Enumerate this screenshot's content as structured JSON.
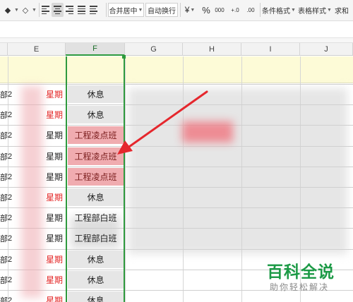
{
  "ribbon": {
    "merge_center_label": "合并居中",
    "wrap_text_label": "自动换行",
    "percent_symbol": "%",
    "thousands_symbol": "000",
    "inc_decimal_label": "+.0",
    "dec_decimal_label": ".00",
    "conditional_format_label": "条件格式",
    "table_style_label": "表格样式",
    "sum_label": "求和"
  },
  "columns": [
    "E",
    "F",
    "G",
    "H",
    "I",
    "J"
  ],
  "rows": [
    {
      "a": "部",
      "b": "2",
      "e": "星期",
      "e_red": true,
      "f": "休息",
      "f_style": "grey"
    },
    {
      "a": "部",
      "b": "2",
      "e": "星期",
      "e_red": true,
      "f": "休息",
      "f_style": "grey"
    },
    {
      "a": "部",
      "b": "2",
      "e": "星期",
      "e_red": false,
      "f": "工程凌点班",
      "f_style": "pink"
    },
    {
      "a": "部",
      "b": "2",
      "e": "星期",
      "e_red": false,
      "f": "工程凌点班",
      "f_style": "pink"
    },
    {
      "a": "部",
      "b": "2",
      "e": "星期",
      "e_red": false,
      "f": "工程凌点班",
      "f_style": "pink"
    },
    {
      "a": "部",
      "b": "2",
      "e": "星期",
      "e_red": true,
      "f": "休息",
      "f_style": "grey"
    },
    {
      "a": "部",
      "b": "2",
      "e": "星期",
      "e_red": false,
      "f": "工程部白班",
      "f_style": "plain"
    },
    {
      "a": "部",
      "b": "2",
      "e": "星期",
      "e_red": false,
      "f": "工程部白班",
      "f_style": "plain"
    },
    {
      "a": "部",
      "b": "2",
      "e": "星期",
      "e_red": true,
      "f": "休息",
      "f_style": "grey"
    },
    {
      "a": "部",
      "b": "2",
      "e": "星期",
      "e_red": true,
      "f": "休息",
      "f_style": "grey"
    },
    {
      "a": "部",
      "b": "2",
      "e": "星期",
      "e_red": true,
      "f": "休息",
      "f_style": "grey"
    }
  ],
  "watermark": {
    "title": "百科全说",
    "subtitle": "助你轻松解决"
  },
  "colors": {
    "selection_green": "#2e9a3e",
    "highlight_pink": "#ea8c91",
    "header_yellow": "#fdfbd7",
    "weekend_red": "#e32222",
    "arrow_red": "#e5272d"
  }
}
